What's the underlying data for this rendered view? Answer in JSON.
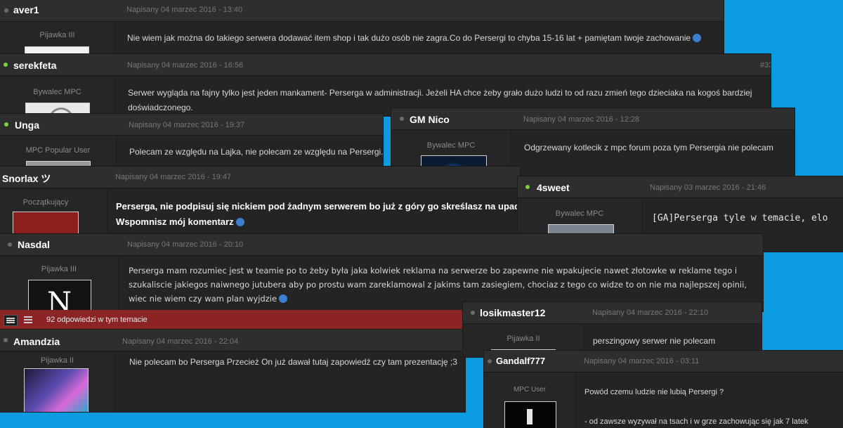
{
  "posts": {
    "aver1": {
      "username": "aver1",
      "date": "Napisany 04 marzec 2016 - 13:40",
      "rank": "Pijawka III",
      "text": "Nie wiem jak można do takiego serwera dodawać item shop i tak dużo osób nie zagra.Co do Persergi to chyba 15-16 lat + pamiętam twoje zachowanie"
    },
    "serekfeta": {
      "username": "serekfeta",
      "date": "Napisany 04 marzec 2016 - 16:56",
      "number": "#33",
      "rank": "Bywalec MPC",
      "text": "Serwer wygląda na fajny tylko jest jeden mankament- Perserga w administracji. Jeżeli HA chce żeby grało dużo ludzi to od razu zmień tego dzieciaka na kogoś bardziej doświadczonego."
    },
    "unga": {
      "username": "Unga",
      "date": "Napisany 04 marzec 2016 - 19:37",
      "rank": "MPC Popular User",
      "text": "Polecam ze względu na Lajka, nie polecam ze względu na Persergi."
    },
    "gmnico": {
      "username": "GM Nico",
      "date": "Napisany 04 marzec 2016 - 12:28",
      "rank": "Bywalec MPC",
      "text": "Odgrzewany kotlecik z mpc forum poza tym Persergia nie polecam"
    },
    "snorlax": {
      "username": "Snorlax ツ",
      "date": "Napisany 04 marzec 2016 - 19:47",
      "rank": "Początkujący",
      "line1": "Perserga, nie podpisuj się nickiem pod żadnym serwerem bo już z góry go skreślasz na upadek.",
      "line2": "Wspomnisz mój komentarz"
    },
    "sweet": {
      "username": "4sweet",
      "date": "Napisany 03 marzec 2016 - 21:46",
      "rank": "Bywalec MPC",
      "text": "[GA]Perserga tyle w temacie, elo"
    },
    "nasdal": {
      "username": "Nasdal",
      "date": "Napisany 04 marzec 2016 - 20:10",
      "rank": "Pijawka III",
      "text": "Perserga mam rozumiec jest w teamie po to żeby była jaka kolwiek reklama na serwerze bo zapewne nie wpakujecie nawet złotowke w reklame tego i szukaliscie jakiegos naiwnego jutubera aby po prostu wam zareklamowal z jakims tam zasiegiem, chociaz z tego co widze to on nie ma najlepszej opinii, wiec nie wiem czy wam plan wyjdzie"
    },
    "losik": {
      "username": "losikmaster12",
      "date": "Napisany 04 marzec 2016 - 22:10",
      "rank": "Pijawka II",
      "text": "perszingowy serwer nie polecam"
    },
    "amandzia": {
      "username": "Amandzia",
      "date": "Napisany 04 marzec 2016 - 22:04",
      "rank": "Pijawka II",
      "text": "Nie polecam bo Perserga   Przecież On już dawał tutaj zapowiedź czy tam prezentację ;3"
    },
    "gandalf": {
      "username": "Gandalf777",
      "date": "Napisany 04 marzec 2016 - 03:11",
      "rank": "MPC User",
      "line1": "Powód czemu ludzie nie lubią Persergi ?",
      "line2": "- od zawsze wyzywał na tsach i w grze zachowując się jak 7 latek"
    }
  },
  "topic_bar": {
    "replies": "92 odpowiedzi w tym temacie"
  },
  "colors": {
    "background": "#0a9be0",
    "post_bg": "#242424",
    "header_bg": "#2e2e2e",
    "online_dot": "#7bd03b",
    "red_bar": "#8c2325"
  }
}
